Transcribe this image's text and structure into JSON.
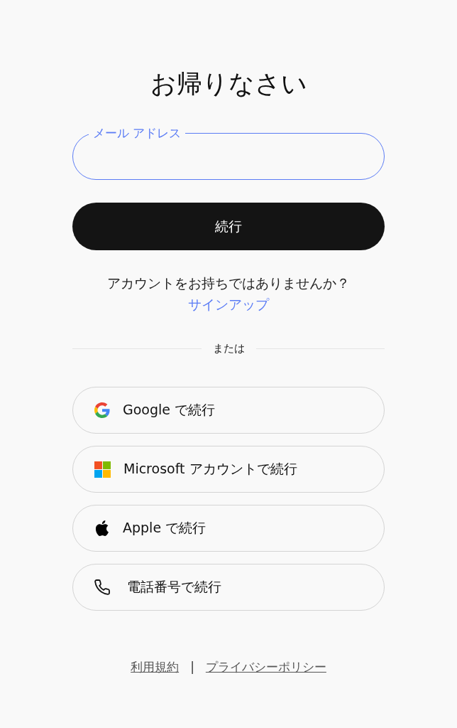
{
  "title": "お帰りなさい",
  "email_field": {
    "label": "メール アドレス",
    "focused": true
  },
  "continue_button": "続行",
  "signup_prompt": {
    "text": "アカウントをお持ちではありませんか？",
    "link": "サインアップ"
  },
  "divider": "または",
  "providers": [
    {
      "kind": "google",
      "label": "Google で続行"
    },
    {
      "kind": "microsoft",
      "label": "Microsoft アカウントで続行"
    },
    {
      "kind": "apple",
      "label": "Apple で続行"
    },
    {
      "kind": "phone",
      "label": "電話番号で続行"
    }
  ],
  "footer": {
    "links": [
      "利用規約",
      "プライバシーポリシー"
    ],
    "separator": "|"
  }
}
